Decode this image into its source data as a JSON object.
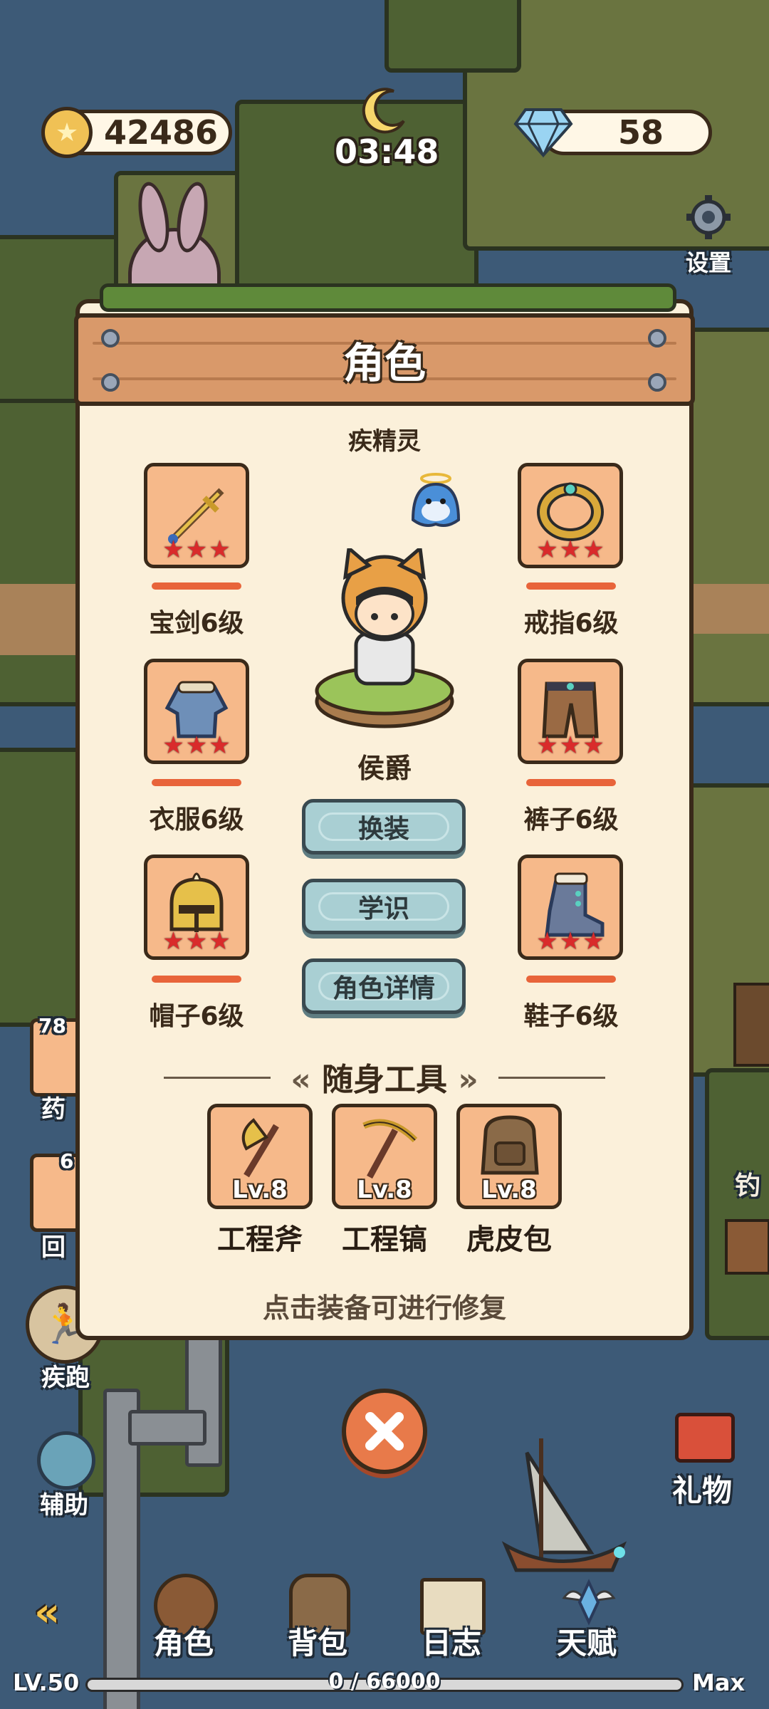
{
  "hud": {
    "coins": "42486",
    "time": "03:48",
    "gems": "58",
    "settings_label": "设置"
  },
  "panel": {
    "title": "角色",
    "pet_name": "疾精灵",
    "character_title": "侯爵",
    "equipment": [
      {
        "id": "sword",
        "label": "宝剑6级",
        "stars": 3
      },
      {
        "id": "ring",
        "label": "戒指6级",
        "stars": 3
      },
      {
        "id": "clothes",
        "label": "衣服6级",
        "stars": 3
      },
      {
        "id": "pants",
        "label": "裤子6级",
        "stars": 3
      },
      {
        "id": "hat",
        "label": "帽子6级",
        "stars": 3
      },
      {
        "id": "shoes",
        "label": "鞋子6级",
        "stars": 3
      }
    ],
    "buttons": {
      "change_outfit": "换装",
      "knowledge": "学识",
      "details": "角色详情"
    },
    "tools_header": "随身工具",
    "tools": [
      {
        "id": "axe",
        "level": "Lv.8",
        "label": "工程斧"
      },
      {
        "id": "pickaxe",
        "level": "Lv.8",
        "label": "工程镐"
      },
      {
        "id": "backpack",
        "level": "Lv.8",
        "label": "虎皮包"
      }
    ],
    "hint": "点击装备可进行修复"
  },
  "side": {
    "potion_count": "78",
    "potion_label": "药",
    "return_count": "6",
    "return_label": "回",
    "sprint_label": "疾跑",
    "assist_label": "辅助",
    "fishing_label": "钓",
    "gift_label": "礼物"
  },
  "nav": {
    "items": [
      "角色",
      "背包",
      "日志",
      "天赋"
    ]
  },
  "xp": {
    "level": "LV.50",
    "progress": "0 / 66000",
    "max": "Max",
    "fraction": 0
  },
  "colors": {
    "panel": "#fbf0da",
    "banner": "#d9996a",
    "star": "#d92b2b",
    "button": "#a9cfd3"
  }
}
